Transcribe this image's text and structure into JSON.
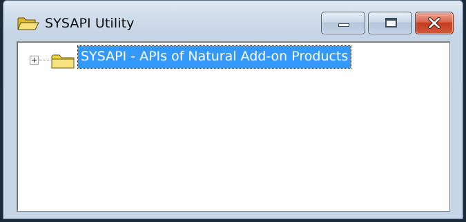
{
  "window": {
    "title": "SYSAPI Utility"
  },
  "tree": {
    "nodes": [
      {
        "label": "SYSAPI - APIs of Natural Add-on Products",
        "expanded": false,
        "selected": true
      }
    ]
  },
  "colors": {
    "selection": "#3399ff",
    "close_button": "#c63a1e",
    "titlebar": "#c6d5e6",
    "folder": "#f2d23a"
  }
}
